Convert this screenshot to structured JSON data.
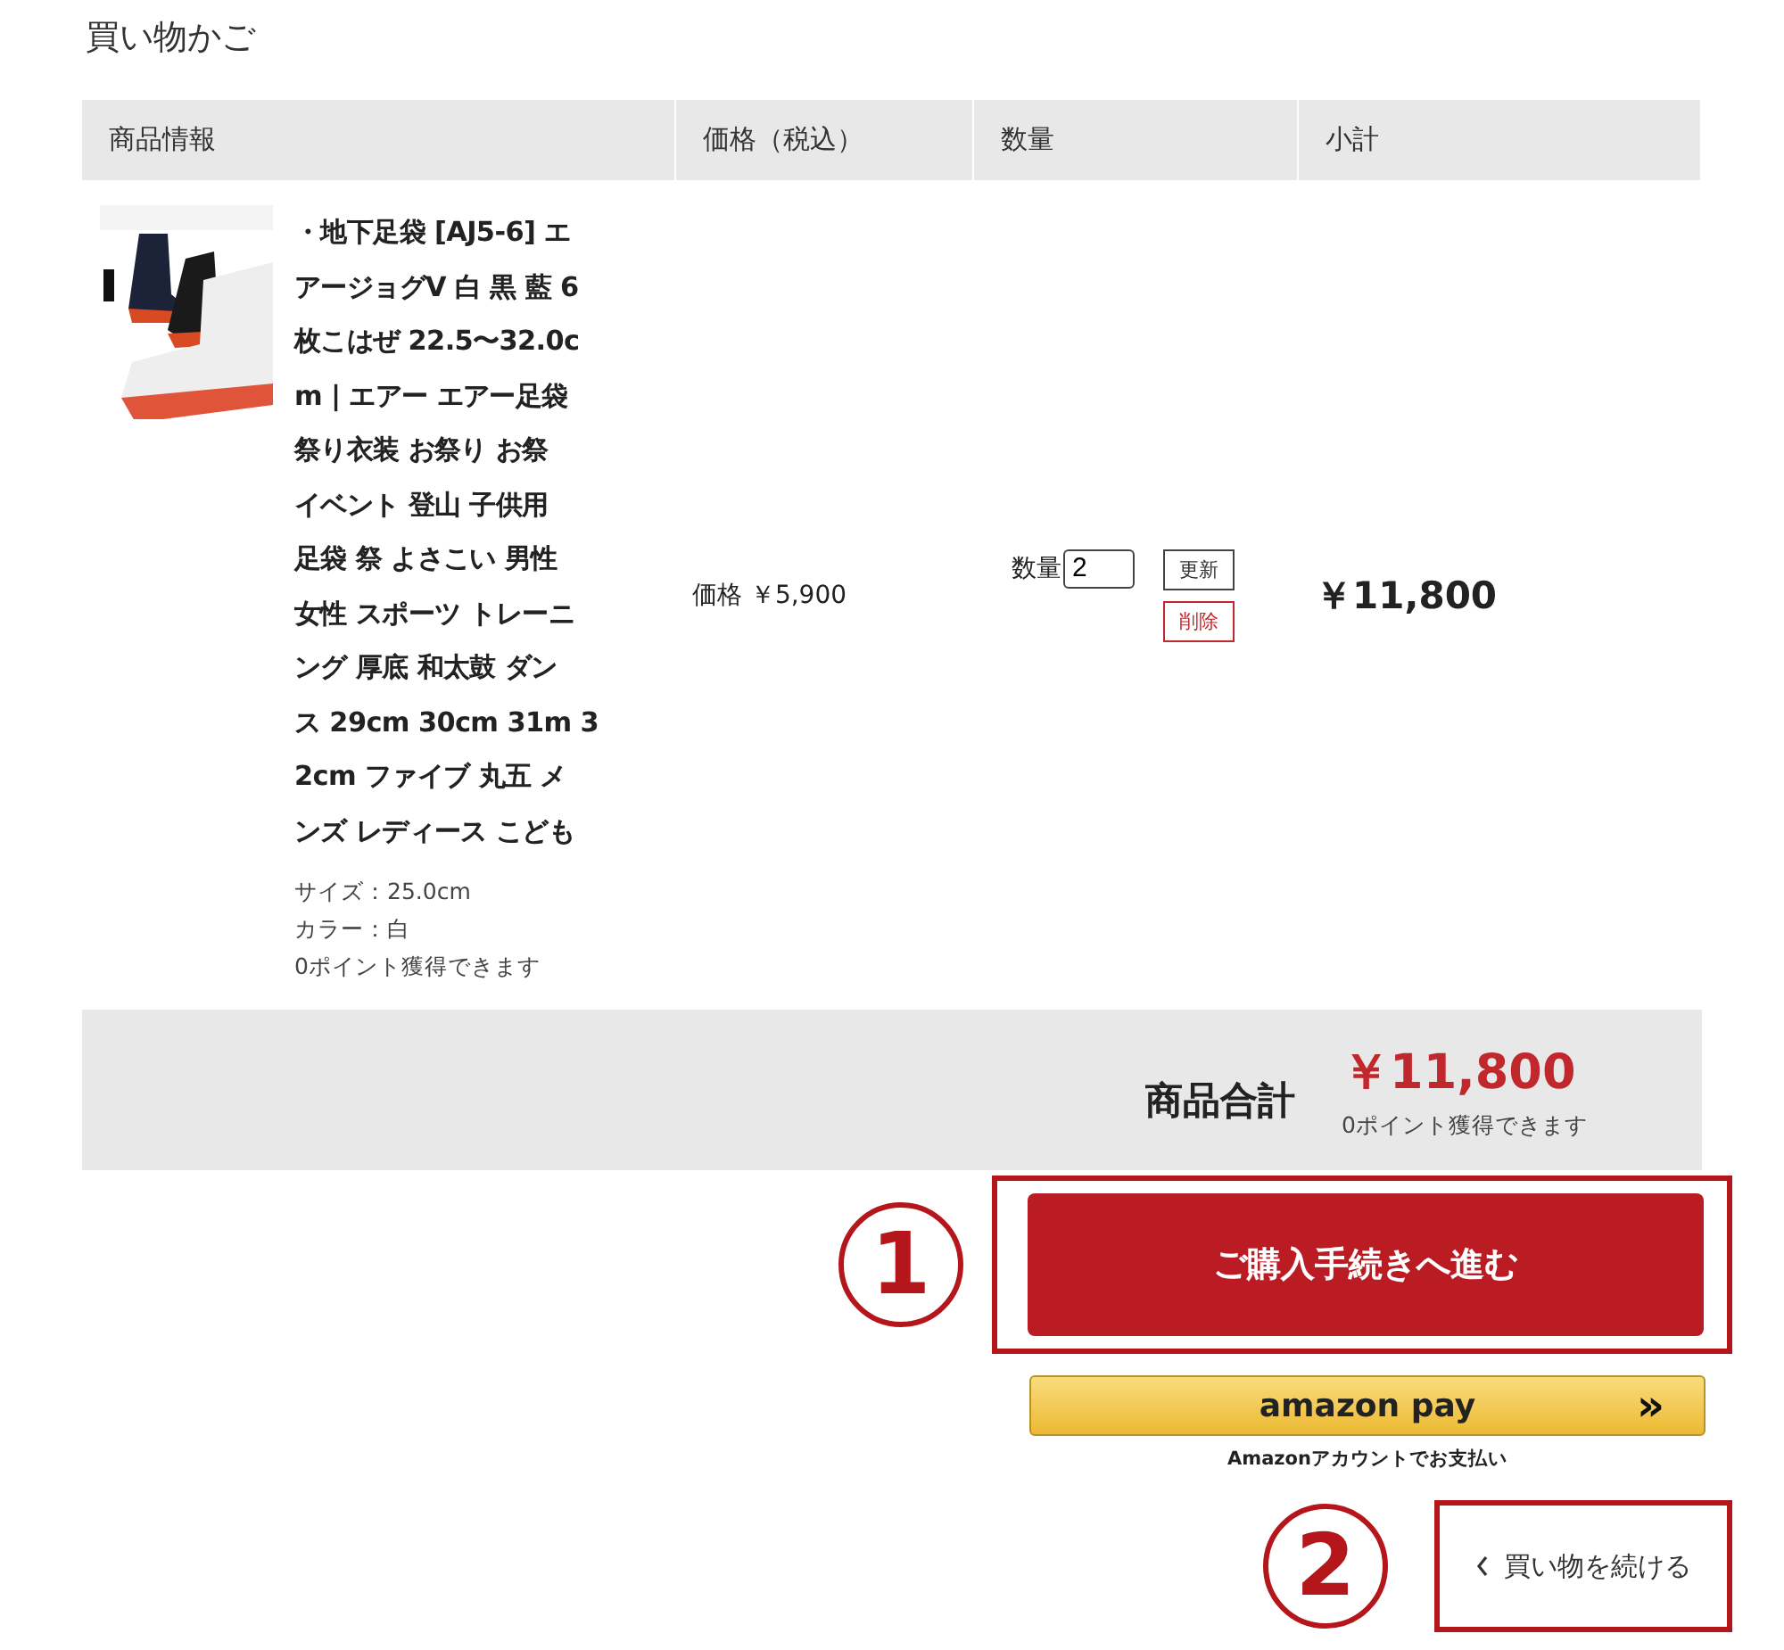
{
  "page_title": "買い物かご",
  "table": {
    "columns": [
      "商品情報",
      "価格（税込）",
      "数量",
      "小計"
    ],
    "rows": [
      {
        "image": {
          "kind": "picture"
        },
        "name_lines": [
          "・地下足袋 [AJ5-6] エ",
          "アージョグV 白 黒 藍 6",
          "枚こはぜ 22.5〜32.0c",
          "m | エアー エアー足袋",
          "祭り衣装 お祭り お祭",
          "イベント 登山 子供用",
          "足袋 祭 よさこい 男性",
          "女性 スポーツ トレーニ",
          "ング 厚底 和太鼓 ダン",
          "ス 29cm 30cm 31m 3",
          "2cm ファイブ 丸五 メ",
          "ンズ レディース こども"
        ],
        "details": [
          "サイズ：25.0cm",
          "カラー：白",
          "0ポイント獲得できます"
        ],
        "price_label": "価格",
        "price": "￥5,900",
        "qty_label": "数量",
        "quantity": "2",
        "update_button": "更新",
        "delete_button": "削除",
        "subtotal": "￥11,800"
      }
    ]
  },
  "total": {
    "label": "商品合計",
    "amount": "￥11,800",
    "points": "0ポイント獲得できます"
  },
  "checkout_button": {
    "label": "ご購入手続きへ進む",
    "annotation": "1"
  },
  "amazon_pay": {
    "logo": "amazon pay",
    "chevrons": "»",
    "caption": "Amazonアカウントでお支払い"
  },
  "continue_button": {
    "label": "買い物を続ける",
    "annotation": "2"
  }
}
